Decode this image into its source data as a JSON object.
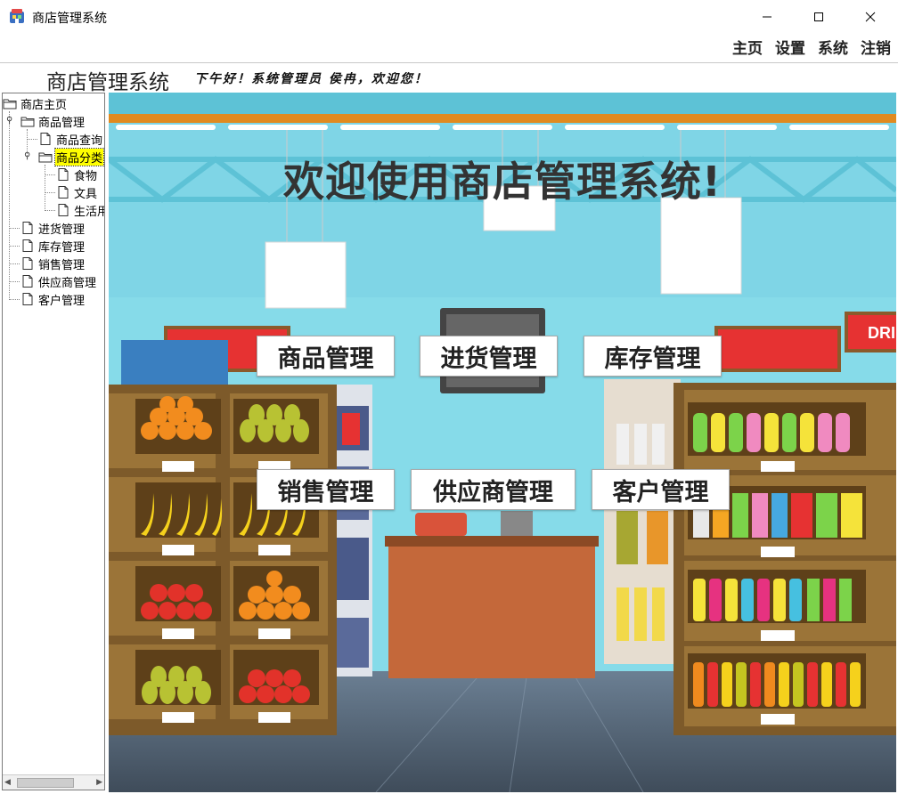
{
  "window": {
    "title": "商店管理系统",
    "controls": {
      "minimize": "—",
      "maximize": "☐",
      "close": "✕"
    }
  },
  "menu": [
    "主页",
    "设置",
    "系统",
    "注销"
  ],
  "header": {
    "system_title": "商店管理系统",
    "welcome": "下午好！系统管理员 侯冉，欢迎您！"
  },
  "tree": {
    "root": "商店主页",
    "goods_management": "商品管理",
    "goods_query": "商品查询",
    "goods_category": "商品分类",
    "category_food": "食物",
    "category_stationery": "文具",
    "category_daily": "生活用品",
    "purchase": "进货管理",
    "inventory": "库存管理",
    "sales": "销售管理",
    "supplier": "供应商管理",
    "customer": "客户管理"
  },
  "main": {
    "banner": "欢迎使用商店管理系统!",
    "sign_text": "DRI",
    "buttons": {
      "goods": "商品管理",
      "purchase": "进货管理",
      "inventory": "库存管理",
      "sales": "销售管理",
      "supplier": "供应商管理",
      "customer": "客户管理"
    }
  },
  "colors": {
    "sky": "#7fd5e6",
    "truss": "#5dc2d6",
    "ceiling_beam": "#e08a20",
    "shelf_wood": "#9b7438",
    "counter": "#c4683a",
    "floor": "#5a6b7c",
    "sign_red": "#e63232",
    "highlight": "#ffff00"
  }
}
